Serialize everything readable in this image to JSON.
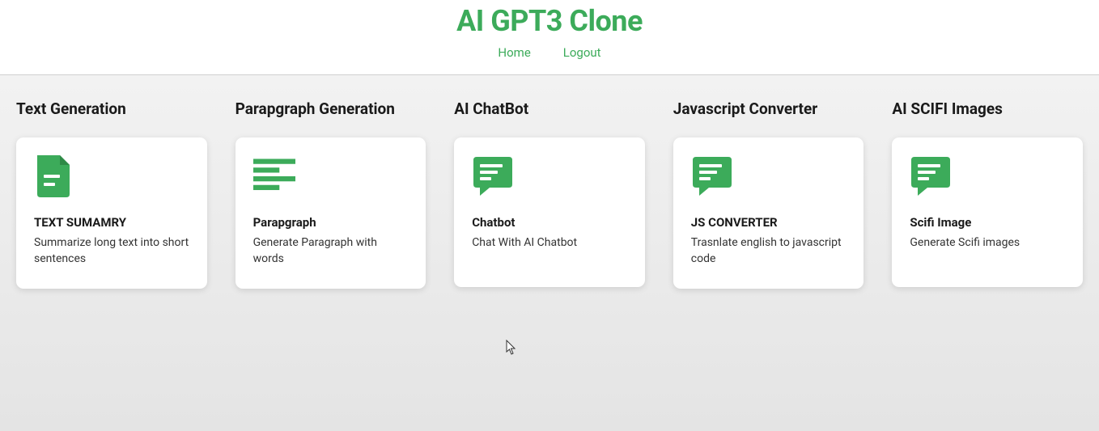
{
  "header": {
    "title": "AI GPT3 Clone",
    "nav": {
      "home": "Home",
      "logout": "Logout"
    }
  },
  "colors": {
    "accent": "#3cab5a"
  },
  "sections": [
    {
      "heading": "Text Generation",
      "card": {
        "icon": "document",
        "title": "TEXT SUMAMRY",
        "desc": "Summarize long text into short sentences"
      }
    },
    {
      "heading": "Parapgraph Generation",
      "card": {
        "icon": "paragraph-lines",
        "title": "Parapgraph",
        "desc": "Generate Paragraph with words"
      }
    },
    {
      "heading": "AI ChatBot",
      "card": {
        "icon": "chat-bubble",
        "title": "Chatbot",
        "desc": "Chat With AI Chatbot"
      }
    },
    {
      "heading": "Javascript Converter",
      "card": {
        "icon": "chat-bubble",
        "title": "JS CONVERTER",
        "desc": "Trasnlate english to javascript code"
      }
    },
    {
      "heading": "AI SCIFI Images",
      "card": {
        "icon": "chat-bubble",
        "title": "Scifi Image",
        "desc": "Generate Scifi images"
      }
    }
  ]
}
